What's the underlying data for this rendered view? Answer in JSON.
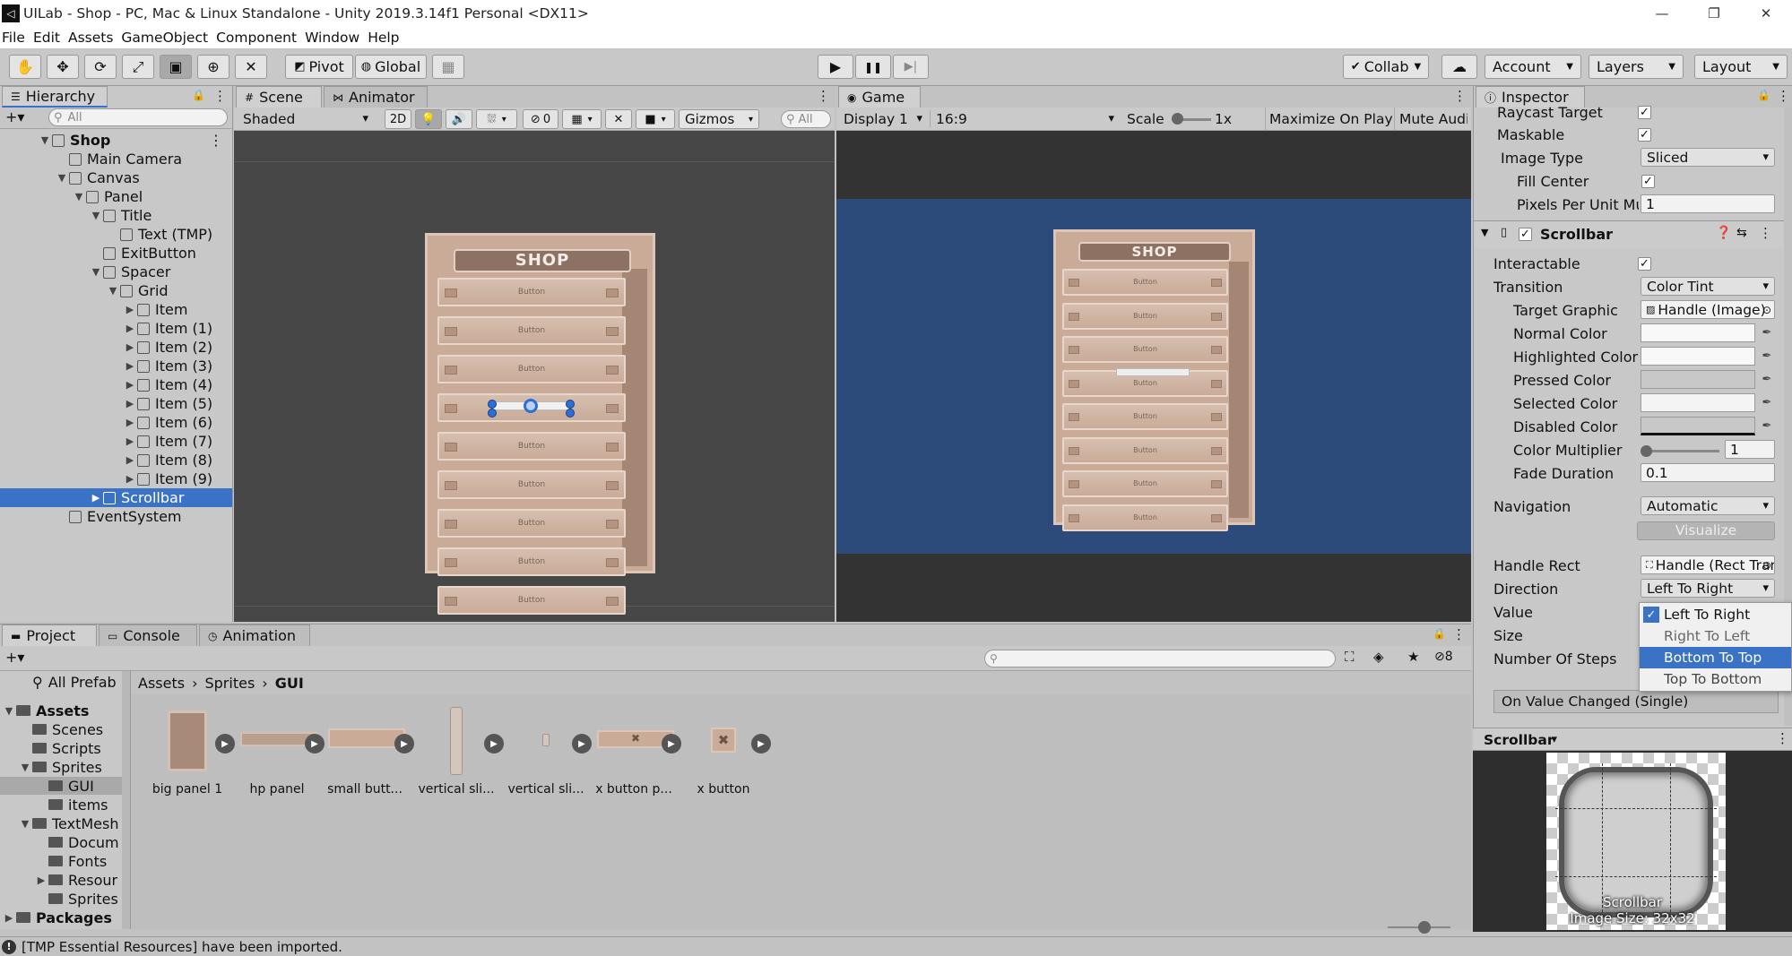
{
  "window": {
    "title": "UILab - Shop - PC, Mac & Linux Standalone - Unity 2019.3.14f1 Personal <DX11>",
    "logo_glyph": "◁",
    "controls": [
      "—",
      "❐",
      "✕"
    ]
  },
  "menu": [
    "File",
    "Edit",
    "Assets",
    "GameObject",
    "Component",
    "Window",
    "Help"
  ],
  "toolbar": {
    "tools": [
      "✋",
      "✥",
      "⟳",
      "⤢",
      "▣",
      "⊕",
      "✕"
    ],
    "pivot": "Pivot",
    "global": "Global",
    "snap_glyph": "▦",
    "play": "▶",
    "pause": "❚❚",
    "step": "▶|",
    "collab": "Collab",
    "cloud_glyph": "☁",
    "account": "Account",
    "layers": "Layers",
    "layout": "Layout"
  },
  "hierarchy": {
    "tab": "Hierarchy",
    "search_placeholder": "All",
    "add_glyph": "+▾",
    "lock_glyph": "🔒",
    "menu_glyph": "⋮",
    "rows": [
      {
        "label": "Shop",
        "depth": 0,
        "expanded": true,
        "bold": true
      },
      {
        "label": "Main Camera",
        "depth": 1
      },
      {
        "label": "Canvas",
        "depth": 1,
        "expanded": true
      },
      {
        "label": "Panel",
        "depth": 2,
        "expanded": true
      },
      {
        "label": "Title",
        "depth": 3,
        "expanded": true
      },
      {
        "label": "Text (TMP)",
        "depth": 4
      },
      {
        "label": "ExitButton",
        "depth": 3
      },
      {
        "label": "Spacer",
        "depth": 3,
        "expanded": true
      },
      {
        "label": "Grid",
        "depth": 4,
        "expanded": true
      },
      {
        "label": "Item",
        "depth": 5,
        "collapsed": true
      },
      {
        "label": "Item (1)",
        "depth": 5,
        "collapsed": true
      },
      {
        "label": "Item (2)",
        "depth": 5,
        "collapsed": true
      },
      {
        "label": "Item (3)",
        "depth": 5,
        "collapsed": true
      },
      {
        "label": "Item (4)",
        "depth": 5,
        "collapsed": true
      },
      {
        "label": "Item (5)",
        "depth": 5,
        "collapsed": true
      },
      {
        "label": "Item (6)",
        "depth": 5,
        "collapsed": true
      },
      {
        "label": "Item (7)",
        "depth": 5,
        "collapsed": true
      },
      {
        "label": "Item (8)",
        "depth": 5,
        "collapsed": true
      },
      {
        "label": "Item (9)",
        "depth": 5,
        "collapsed": true
      },
      {
        "label": "Scrollbar",
        "depth": 3,
        "collapsed": true,
        "selected": true
      },
      {
        "label": "EventSystem",
        "depth": 1
      }
    ]
  },
  "scene": {
    "tab": "Scene",
    "animator_tab": "Animator",
    "shading": "Shaded",
    "mode2d": "2D",
    "light_glyph": "💡",
    "audio_glyph": "🔊",
    "fx_glyph": "⛆",
    "hidden_count": "0",
    "gizmos": "Gizmos",
    "search_placeholder": "All",
    "shop_title": "SHOP",
    "button_label": "Button",
    "shelf_count": 9
  },
  "game": {
    "tab": "Game",
    "display": "Display 1",
    "aspect": "16:9",
    "scale_label": "Scale",
    "scale_value": "1x",
    "maximize": "Maximize On Play",
    "mute": "Mute Audio",
    "shop_title": "SHOP",
    "button_label": "Button",
    "shelf_count": 8
  },
  "inspector": {
    "tab": "Inspector",
    "image": {
      "raycast_target": "Raycast Target",
      "maskable": "Maskable",
      "image_type_label": "Image Type",
      "image_type": "Sliced",
      "fill_center": "Fill Center",
      "ppu_label": "Pixels Per Unit Mu",
      "ppu_value": "1"
    },
    "scrollbar": {
      "header": "Scrollbar",
      "interactable": "Interactable",
      "transition_label": "Transition",
      "transition": "Color Tint",
      "target_graphic_label": "Target Graphic",
      "target_graphic": "Handle (Image)",
      "normal_color": "Normal Color",
      "highlighted_color": "Highlighted Color",
      "pressed_color": "Pressed Color",
      "selected_color": "Selected Color",
      "disabled_color": "Disabled Color",
      "color_multiplier_label": "Color Multiplier",
      "color_multiplier": "1",
      "fade_duration_label": "Fade Duration",
      "fade_duration": "0.1",
      "navigation_label": "Navigation",
      "navigation": "Automatic",
      "visualize": "Visualize",
      "handle_rect_label": "Handle Rect",
      "handle_rect": "Handle (Rect Transform)",
      "direction_label": "Direction",
      "direction": "Left To Right",
      "value_label": "Value",
      "size_label": "Size",
      "steps_label": "Number Of Steps",
      "on_value_changed": "On Value Changed (Single)",
      "direction_options": [
        "Left To Right",
        "Right To Left",
        "Bottom To Top",
        "Top To Bottom"
      ],
      "direction_checked_index": 0,
      "direction_hover_index": 2
    },
    "preview": {
      "title": "Scrollbar",
      "caption": "Scrollbar",
      "size": "Image Size: 32x32"
    }
  },
  "bottom": {
    "tabs": [
      "Project",
      "Console",
      "Animation"
    ],
    "search_placeholder": "",
    "hidden_count": "8",
    "favorites": "All Prefab",
    "breadcrumb": [
      "Assets",
      "Sprites",
      "GUI"
    ],
    "tree": [
      {
        "label": "Assets",
        "depth": 0,
        "expanded": true,
        "bold": true
      },
      {
        "label": "Scenes",
        "depth": 1
      },
      {
        "label": "Scripts",
        "depth": 1
      },
      {
        "label": "Sprites",
        "depth": 1,
        "expanded": true
      },
      {
        "label": "GUI",
        "depth": 2,
        "selected": true
      },
      {
        "label": "items",
        "depth": 2
      },
      {
        "label": "TextMesh",
        "depth": 1,
        "expanded": true
      },
      {
        "label": "Docum",
        "depth": 2
      },
      {
        "label": "Fonts",
        "depth": 2
      },
      {
        "label": "Resour",
        "depth": 2,
        "collapsed": true
      },
      {
        "label": "Sprites",
        "depth": 2
      },
      {
        "label": "Packages",
        "depth": 0,
        "collapsed": true,
        "bold": true
      }
    ],
    "assets": [
      "big panel 1",
      "hp panel",
      "small butt...",
      "vertical sli...",
      "vertical sli...",
      "x button p...",
      "x button"
    ]
  },
  "status": {
    "message": "[TMP Essential Resources] have been imported.",
    "icon_glyph": "!"
  },
  "colors": {
    "selection": "#3a72c6",
    "game_bg": "#2c4a7a",
    "scene_bg": "#474747",
    "wood": "#c9ab98"
  }
}
